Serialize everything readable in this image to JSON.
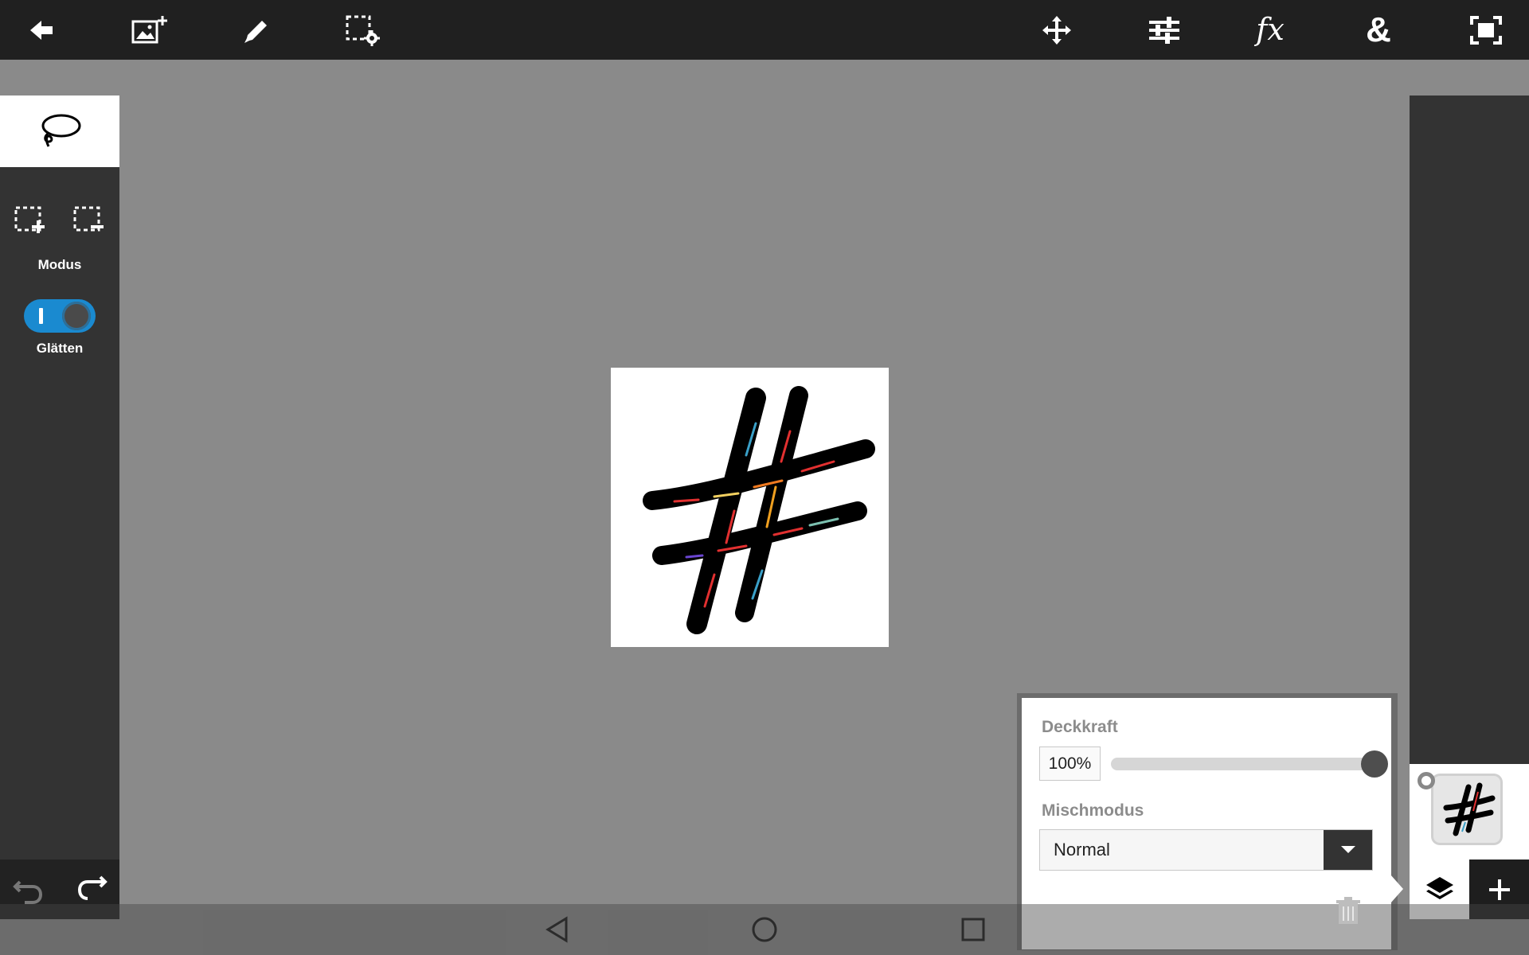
{
  "toolbar": {
    "left_icons": [
      "back-arrow-icon",
      "add-image-icon",
      "brush-icon",
      "selection-settings-icon"
    ],
    "right_icons": [
      "move-icon",
      "adjustments-icon",
      "fx-icon",
      "ampersand-icon",
      "fit-screen-icon"
    ],
    "fx_label": "fx",
    "amp_label": "&"
  },
  "left_panel": {
    "tool": "lasso-icon",
    "mode_label": "Modus",
    "smooth_label": "Glätten",
    "smooth_enabled": true
  },
  "layer_properties": {
    "opacity_label": "Deckkraft",
    "opacity_value": "100%",
    "opacity_level": 1.0,
    "blend_label": "Mischmodus",
    "blend_value": "Normal"
  },
  "colors": {
    "toolbar_bg": "#202020",
    "canvas_bg": "#8a8a8a",
    "panel_bg": "#333333",
    "toggle_accent": "#1a8ad0"
  }
}
